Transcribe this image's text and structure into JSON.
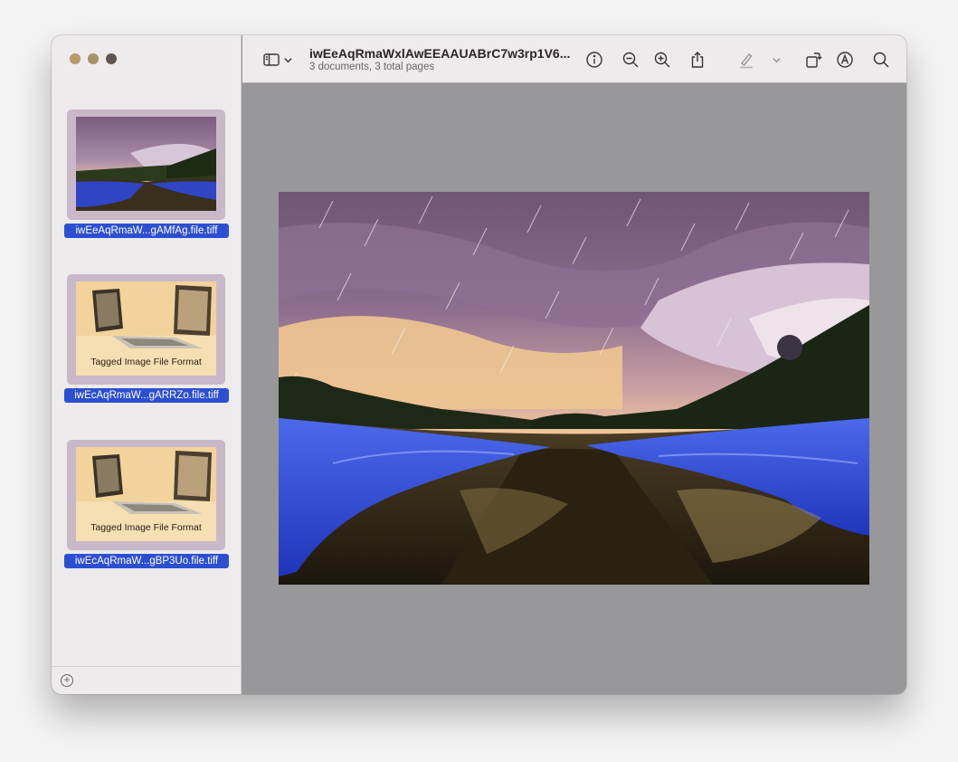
{
  "window": {
    "title": "iwEeAqRmaWxlAwEEAAUABrC7w3rp1V6...",
    "subtitle": "3 documents, 3 total pages"
  },
  "sidebar": {
    "thumbnails": [
      {
        "label": "iwEeAqRmaW...gAMfAg.file.tiff",
        "caption": ""
      },
      {
        "label": "iwEcAqRmaW...gARRZo.file.tiff",
        "caption": "Tagged Image File Format"
      },
      {
        "label": "iwEcAqRmaW...gBP3Uo.file.tiff",
        "caption": "Tagged Image File Format"
      }
    ]
  },
  "toolbar": {
    "icons": [
      "sidebar-toggle-icon",
      "chevron-down-icon",
      "info-icon",
      "zoom-out-icon",
      "zoom-in-icon",
      "share-icon",
      "highlight-pen-icon",
      "chevron-down-icon",
      "rotate-icon",
      "markup-icon",
      "search-icon"
    ]
  },
  "colors": {
    "selection": "#2c4fd1",
    "canvas": "#98979a",
    "sidebar": "#edebec"
  }
}
